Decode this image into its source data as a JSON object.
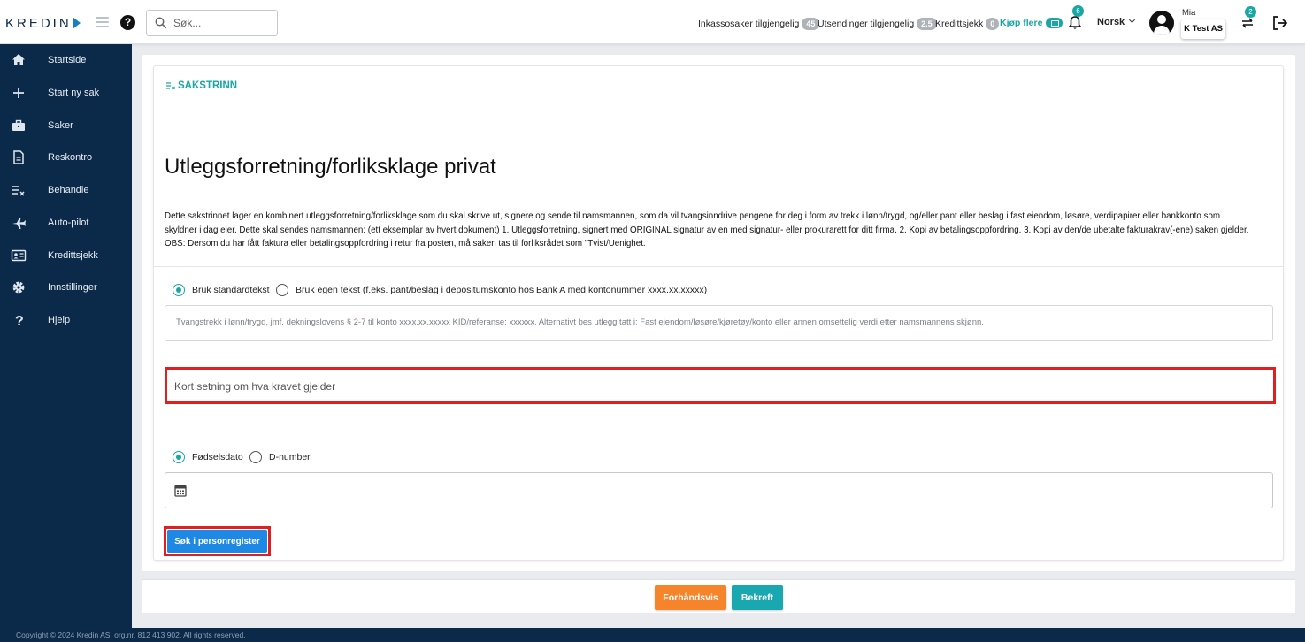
{
  "brand": {
    "logo_text": "KREDIN",
    "accent": "#19a7a5",
    "navy": "#0b2a4a"
  },
  "header": {
    "search_placeholder": "Søk...",
    "stats": [
      {
        "label": "Inkassosaker tilgjengelig",
        "count": "45"
      },
      {
        "label": "Utsendinger tilgjengelig",
        "count": "2.5"
      },
      {
        "label": "Kredittsjekk",
        "count": "0"
      }
    ],
    "buy_more": "Kjøp flere",
    "notifications_count": "6",
    "language": "Norsk",
    "user_name": "Mia",
    "company": "K Test AS",
    "swap_count": "2"
  },
  "sidebar": {
    "items": [
      {
        "label": "Startside",
        "icon": "home-icon"
      },
      {
        "label": "Start ny sak",
        "icon": "plus-icon"
      },
      {
        "label": "Saker",
        "icon": "briefcase-icon"
      },
      {
        "label": "Reskontro",
        "icon": "document-icon"
      },
      {
        "label": "Behandle",
        "icon": "checklist-icon"
      },
      {
        "label": "Auto-pilot",
        "icon": "airplane-icon"
      },
      {
        "label": "Kredittsjekk",
        "icon": "id-card-icon"
      },
      {
        "label": "Innstillinger",
        "icon": "gear-icon"
      },
      {
        "label": "Hjelp",
        "icon": "question-icon"
      }
    ]
  },
  "card": {
    "header_title": "SAKSTRINN",
    "title": "Utleggsforretning/forliksklage privat",
    "description": "Dette sakstrinnet lager en kombinert utleggsforretning/forliksklage som du skal skrive ut, signere og sende til namsmannen, som da vil tvangsinndrive pengene for deg i form av trekk i lønn/trygd, og/eller pant eller beslag i fast eiendom, løsøre, verdipapirer eller bankkonto som skyldner i dag eier. Dette skal sendes namsmannen: (ett eksemplar av hvert dokument) 1. Utleggsforretning, signert med ORIGINAL signatur av en med signatur- eller prokurarett for ditt firma. 2. Kopi av betalingsoppfordring. 3. Kopi av den/de ubetalte fakturakrav(-ene) saken gjelder. OBS: Dersom du har fått faktura eller betalingsoppfordring i retur fra posten, må saken tas til forliksrådet som \"Tvist/Uenighet.",
    "text_options": {
      "standard": "Bruk standardtekst",
      "custom": "Bruk egen tekst (f.eks. pant/beslag i depositumskonto hos Bank A med kontonummer xxxx.xx.xxxxx)",
      "selected": "standard"
    },
    "standard_text": "Tvangstrekk i lønn/trygd, jmf. dekningslovens § 2-7 til konto xxxx.xx.xxxxx KID/referanse: xxxxxx. Alternativt bes utlegg tatt i: Fast eiendom/løsøre/kjøretøy/konto eller annen omsettelig verdi etter namsmannens skjønn.",
    "claim_placeholder": "Kort setning om hva kravet gjelder",
    "id_options": {
      "birthdate": "Fødselsdato",
      "dnumber": "D-number",
      "selected": "birthdate"
    },
    "search_button": "Søk i personregister"
  },
  "actions": {
    "preview": "Forhåndsvis",
    "confirm": "Bekreft"
  },
  "footer": "Copyright © 2024 Kredin AS, org.nr. 812 413 902. All rights reserved."
}
